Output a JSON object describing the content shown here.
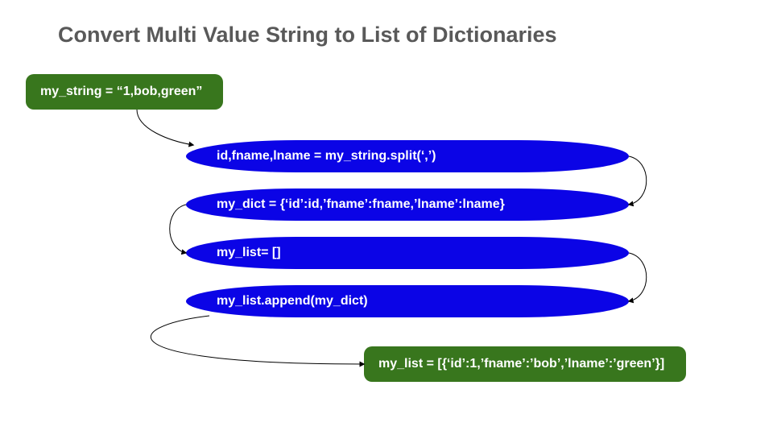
{
  "title": "Convert Multi Value String to List of Dictionaries",
  "colors": {
    "green": "#38761d",
    "blue": "#0b04e6",
    "titleGray": "#595959",
    "arrow": "#000000"
  },
  "input_box": {
    "text": "my_string = “1,bob,green”"
  },
  "steps": [
    {
      "text": "id,fname,lname = my_string.split(‘,’)"
    },
    {
      "text": "my_dict = {‘id’:id,’fname’:fname,’lname’:lname}"
    },
    {
      "text": "my_list= []"
    },
    {
      "text": "my_list.append(my_dict)"
    }
  ],
  "output_box": {
    "text": "my_list = [{‘id’:1,’fname’:’bob’,’lname’:’green’}]"
  }
}
